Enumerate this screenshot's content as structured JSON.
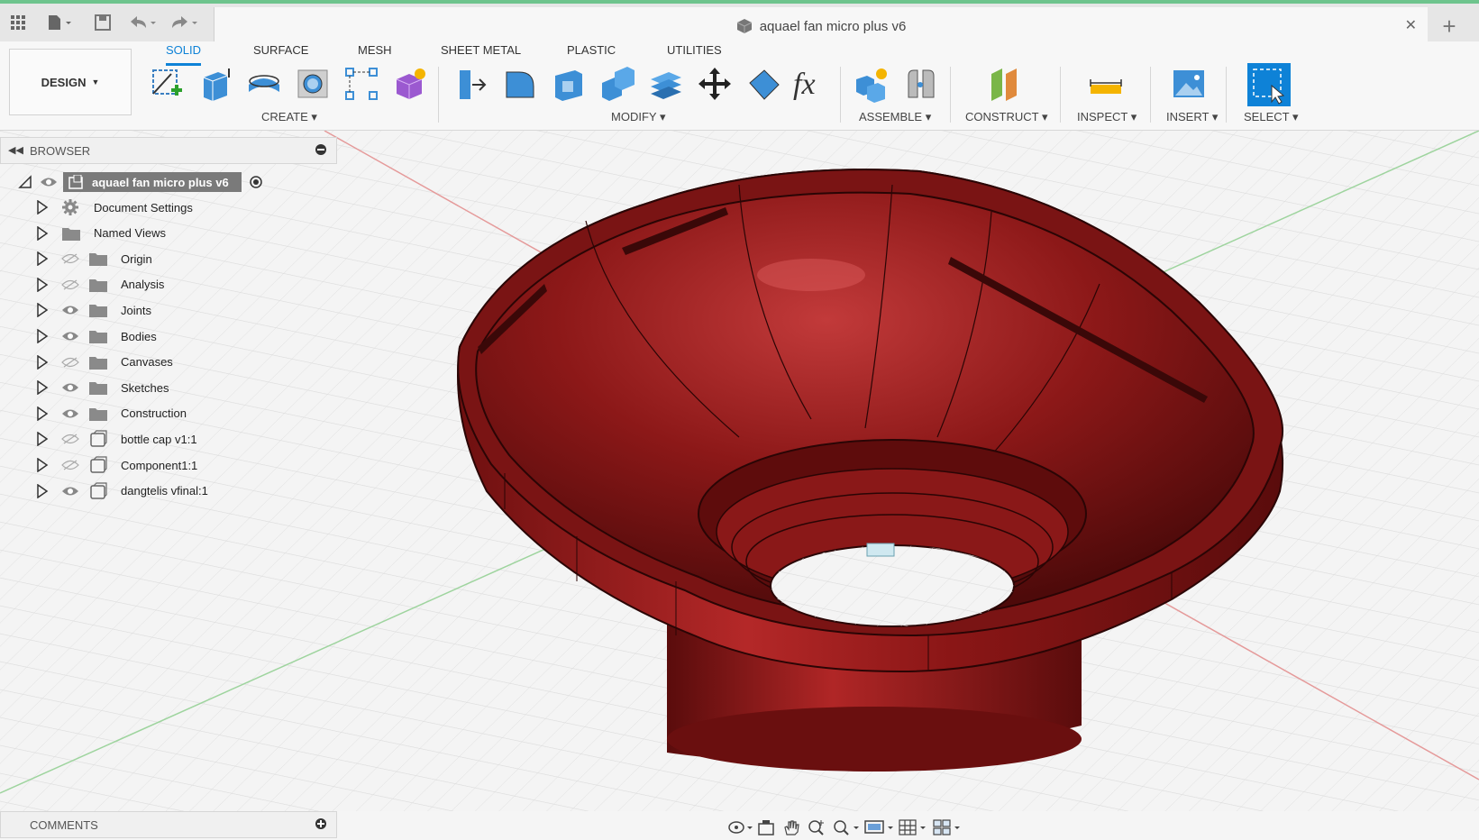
{
  "app": {
    "document_title": "aquael fan micro plus v6",
    "accent_color": "#0e82d7",
    "model_color": "#a21e1e"
  },
  "quick_access": [
    {
      "icon": "apps-grid-icon"
    },
    {
      "icon": "file-menu-icon"
    },
    {
      "icon": "save-icon"
    },
    {
      "icon": "undo-icon"
    },
    {
      "icon": "redo-icon"
    }
  ],
  "workspace": {
    "label": "DESIGN"
  },
  "tabs": [
    {
      "label": "SOLID",
      "active": true
    },
    {
      "label": "SURFACE",
      "active": false
    },
    {
      "label": "MESH",
      "active": false
    },
    {
      "label": "SHEET METAL",
      "active": false
    },
    {
      "label": "PLASTIC",
      "active": false
    },
    {
      "label": "UTILITIES",
      "active": false
    }
  ],
  "groups": {
    "create": "CREATE",
    "modify": "MODIFY",
    "assemble": "ASSEMBLE",
    "construct": "CONSTRUCT",
    "inspect": "INSPECT",
    "insert": "INSERT",
    "select": "SELECT"
  },
  "browser": {
    "title": "BROWSER",
    "root": "aquael fan micro plus v6",
    "items": [
      {
        "label": "Document Settings",
        "icon": "gear-icon",
        "visibility": "none"
      },
      {
        "label": "Named Views",
        "icon": "folder-icon",
        "visibility": "none"
      },
      {
        "label": "Origin",
        "icon": "folder-icon",
        "visibility": "hidden"
      },
      {
        "label": "Analysis",
        "icon": "folder-icon",
        "visibility": "hidden"
      },
      {
        "label": "Joints",
        "icon": "folder-icon",
        "visibility": "visible"
      },
      {
        "label": "Bodies",
        "icon": "folder-icon",
        "visibility": "visible"
      },
      {
        "label": "Canvases",
        "icon": "folder-icon",
        "visibility": "hidden"
      },
      {
        "label": "Sketches",
        "icon": "folder-icon",
        "visibility": "visible"
      },
      {
        "label": "Construction",
        "icon": "folder-icon",
        "visibility": "visible"
      },
      {
        "label": "bottle cap v1:1",
        "icon": "component-icon",
        "visibility": "hidden"
      },
      {
        "label": "Component1:1",
        "icon": "component-icon",
        "visibility": "hidden"
      },
      {
        "label": "dangtelis vfinal:1",
        "icon": "component-icon",
        "visibility": "visible"
      }
    ]
  },
  "comments": {
    "title": "COMMENTS"
  },
  "navbar": [
    {
      "icon": "orbit-icon"
    },
    {
      "icon": "look-at-icon"
    },
    {
      "icon": "pan-icon"
    },
    {
      "icon": "zoom-icon"
    },
    {
      "icon": "fit-icon"
    },
    {
      "icon": "display-settings-icon"
    },
    {
      "icon": "grid-settings-icon"
    },
    {
      "icon": "viewports-icon"
    }
  ]
}
